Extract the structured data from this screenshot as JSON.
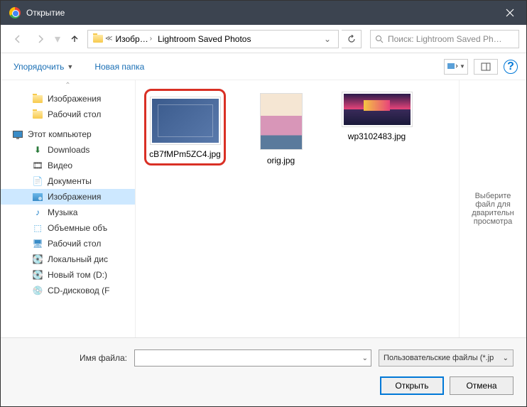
{
  "window": {
    "title": "Открытие"
  },
  "nav": {
    "breadcrumb": {
      "root_icon": "folder",
      "crumb1": "Изобр…",
      "crumb2": "Lightroom Saved Photos"
    },
    "search_placeholder": "Поиск: Lightroom Saved Ph…"
  },
  "toolbar": {
    "organize": "Упорядочить",
    "newfolder": "Новая папка"
  },
  "tree": {
    "images": "Изображения",
    "desktop": "Рабочий стол",
    "thispc": "Этот компьютер",
    "downloads": "Downloads",
    "videos": "Видео",
    "documents": "Документы",
    "images2": "Изображения",
    "music": "Музыка",
    "volumes": "Объемные объ",
    "desktop2": "Рабочий стол",
    "localdisk": "Локальный дис",
    "newvol": "Новый том (D:)",
    "cddrive": "CD-дисковод (F"
  },
  "files": [
    {
      "name": "cB7fMPm5ZC4.jpg"
    },
    {
      "name": "orig.jpg"
    },
    {
      "name": "wp3102483.jpg"
    }
  ],
  "preview": {
    "text": "Выберите файл для дварительн просмотра"
  },
  "footer": {
    "filename_label": "Имя файла:",
    "filename_value": "",
    "filter": "Пользовательские файлы (*.jp",
    "open": "Открыть",
    "cancel": "Отмена"
  }
}
